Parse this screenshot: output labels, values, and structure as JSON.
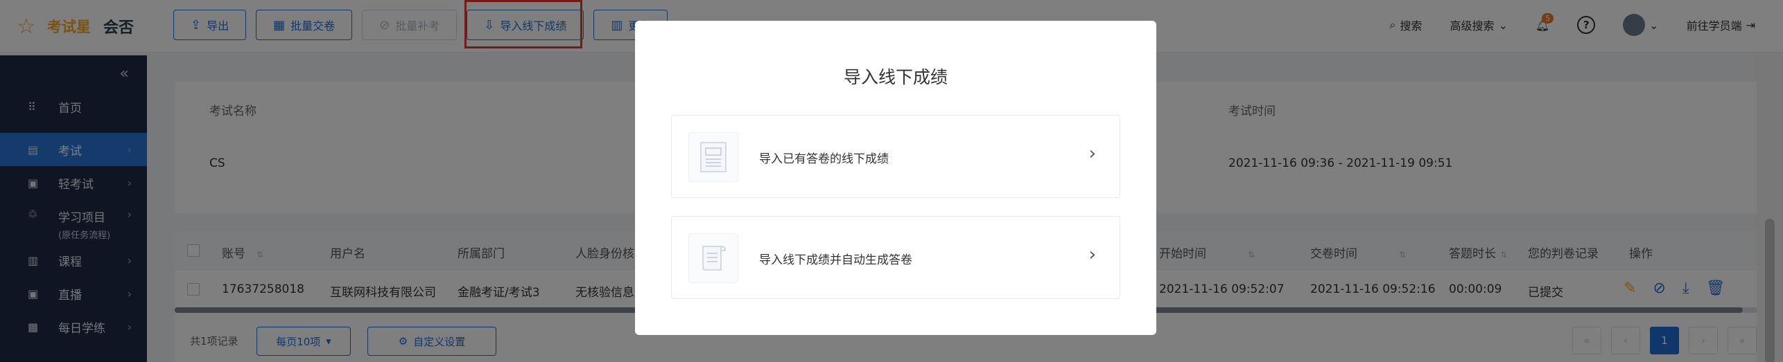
{
  "topbar": {
    "brand_name": "考试星",
    "brand_sub": "会否",
    "toolbar": [
      {
        "label": "导出",
        "icon": "export-icon",
        "disabled": false
      },
      {
        "label": "批量交卷",
        "icon": "batch-submit-icon",
        "disabled": false
      },
      {
        "label": "批量补考",
        "icon": "retake-icon",
        "disabled": true
      },
      {
        "label": "导入线下成绩",
        "icon": "import-icon",
        "disabled": false
      },
      {
        "label": "更多",
        "icon": "grid-icon",
        "disabled": false
      }
    ],
    "search_label": "搜索",
    "advanced_search_label": "高级搜索",
    "notification_count": "5",
    "student_end_label": "前往学员端"
  },
  "sidebar": {
    "items": [
      {
        "label": "首页",
        "icon": "grid-icon",
        "active": false,
        "arrow": false
      },
      {
        "label": "考试",
        "icon": "exam-icon",
        "active": true,
        "arrow": true
      },
      {
        "label": "轻考试",
        "icon": "light-exam-icon",
        "active": false,
        "arrow": true
      },
      {
        "label": "学习项目",
        "sub": "(原任务流程)",
        "icon": "project-icon",
        "active": false,
        "arrow": true
      },
      {
        "label": "课程",
        "icon": "book-icon",
        "active": false,
        "arrow": true
      },
      {
        "label": "直播",
        "icon": "live-icon",
        "active": false,
        "arrow": true
      },
      {
        "label": "每日学练",
        "icon": "daily-icon",
        "active": false,
        "arrow": true
      }
    ]
  },
  "exam_info": {
    "name_label": "考试名称",
    "name_value": "CS",
    "time_label": "考试时间",
    "time_value": "2021-11-16 09:36 - 2021-11-19 09:51"
  },
  "table": {
    "columns": [
      "账号",
      "用户名",
      "所属部门",
      "人脸身份核",
      "开始时间",
      "交卷时间",
      "答题时长",
      "您的判卷记录",
      "操作"
    ],
    "rows": [
      [
        "17637258018",
        "互联网科技有限公司",
        "金融考证/考试3",
        "无核验信息",
        "2021-11-16 09:52:07",
        "2021-11-16 09:52:16",
        "00:00:09",
        "已提交"
      ]
    ]
  },
  "footer": {
    "total": "共1项记录",
    "page_size": "每页10项",
    "custom_settings": "自定义设置",
    "current_page": "1"
  },
  "modal": {
    "title": "导入线下成绩",
    "options": [
      {
        "label": "导入已有答卷的线下成绩",
        "icon": "score-sheet-icon"
      },
      {
        "label": "导入线下成绩并自动生成答卷",
        "icon": "scroll-doc-icon"
      }
    ]
  },
  "colors": {
    "primary": "#1e6fd9",
    "sidebar_bg": "#1f2b46",
    "brand": "#f5a623",
    "highlight": "#e53935"
  }
}
